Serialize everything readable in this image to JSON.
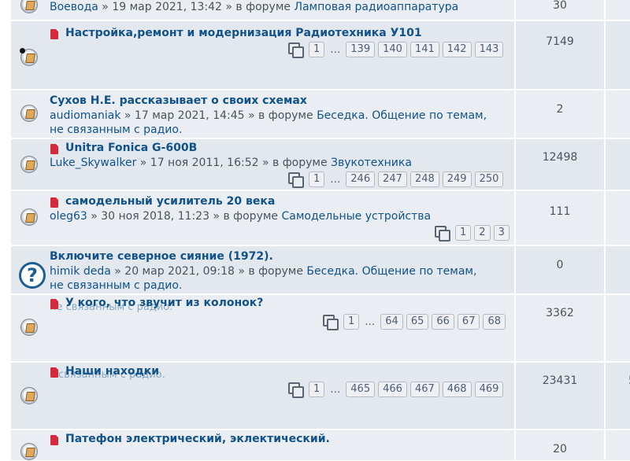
{
  "topics": [
    {
      "meta_author": "Воевода",
      "meta_date": " » 19 мар 2021, 13:42 » в форуме ",
      "meta_forum": "Ламповая радиоаппаратура",
      "count": "30"
    },
    {
      "title": "Настройка,ремонт и модернизация Радиотехника У101",
      "pages": [
        "1",
        "…",
        "139",
        "140",
        "141",
        "142",
        "143"
      ],
      "count": "7149"
    },
    {
      "title": "Сухов Н.Е. рассказывает о своих схемах",
      "meta_author": "audiomaniak",
      "meta_date": " » 17 мар 2021, 14:45 » в форуме ",
      "meta_forum": "Беседка. Общение по темам,",
      "meta_line2": "не связанным с радио.",
      "count": "2"
    },
    {
      "title": "Unitra Fonica G-600B",
      "meta_author": "Luke_Skywalker",
      "meta_date": " » 17 ноя 2011, 16:52 » в форуме ",
      "meta_forum": "Звукотехника",
      "pages": [
        "1",
        "…",
        "246",
        "247",
        "248",
        "249",
        "250"
      ],
      "count": "12498"
    },
    {
      "title": "самодельный усилитель 20 века",
      "meta_author": "oleg63",
      "meta_date": " » 30 ноя 2018, 11:23 » в форуме ",
      "meta_forum": "Самодельные устройства",
      "pages": [
        "1",
        "2",
        "3"
      ],
      "count": "111"
    },
    {
      "title": "Включите северное сияние (1972).",
      "meta_author": "himik deda",
      "meta_date": " » 20 мар 2021, 09:18 » в форуме ",
      "meta_forum": "Беседка. Общение по темам,",
      "meta_line2": "не связанным с радио.",
      "count": "0"
    },
    {
      "title": "У кого, что звучит из колонок?",
      "pages": [
        "1",
        "…",
        "64",
        "65",
        "66",
        "67",
        "68"
      ],
      "count": "3362"
    },
    {
      "title": "Наши находки",
      "pages": [
        "1",
        "…",
        "465",
        "466",
        "467",
        "468",
        "469"
      ],
      "count": "23431",
      "count_right": "5"
    },
    {
      "title": "Патефон электрический, эклектический.",
      "count": "20"
    }
  ],
  "ghost_texts": [
    "не связанным с радио.",
    "связанным с радио."
  ]
}
